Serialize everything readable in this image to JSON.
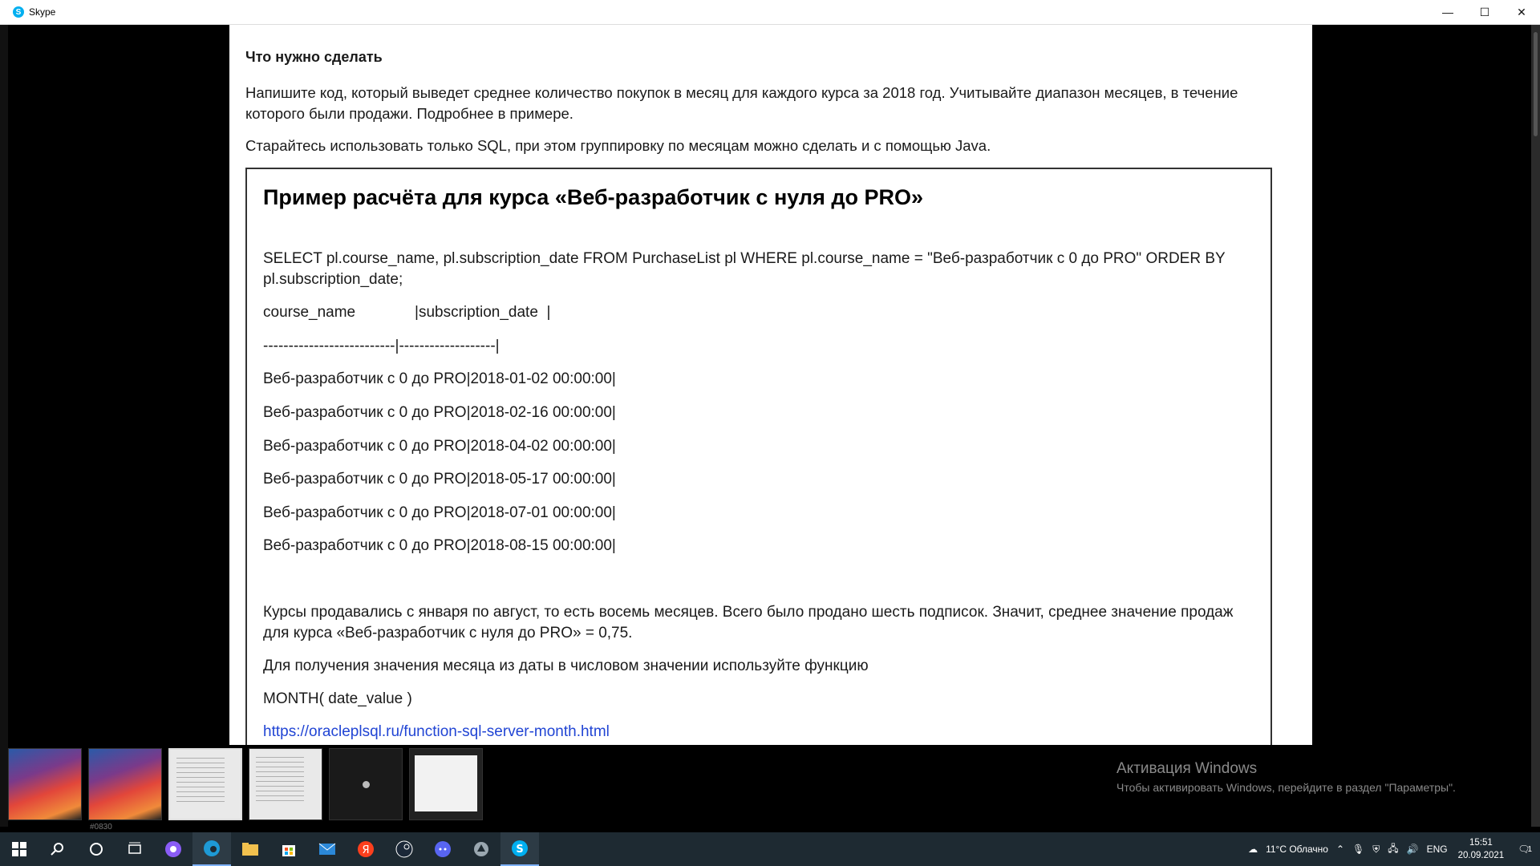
{
  "window": {
    "title": "Skype",
    "app_icon_letter": "S",
    "minimize": "—",
    "maximize": "☐",
    "close": "✕"
  },
  "doc": {
    "section_title": "Что нужно сделать",
    "para1": "Напишите код, который выведет среднее количество покупок в месяц для каждого курса за 2018 год. Учитывайте диапазон месяцев, в течение которого были продажи. Подробнее в примере.",
    "para2": "Старайтесь использовать только SQL, при этом  группировку по месяцам можно сделать и с помощью Java.",
    "example_title": "Пример расчёта для курса «Веб-разработчик с нуля до PRO»",
    "query": "SELECT pl.course_name, pl.subscription_date FROM PurchaseList pl WHERE pl.course_name = \"Веб-разработчик с 0 до PRO\" ORDER BY pl.subscription_date;",
    "header_row": "course_name              |subscription_date  |",
    "separator": "--------------------------|-------------------|",
    "rows": [
      "Веб-разработчик с 0 до PRO|2018-01-02 00:00:00|",
      "Веб-разработчик с 0 до PRO|2018-02-16 00:00:00|",
      "Веб-разработчик с 0 до PRO|2018-04-02 00:00:00|",
      "Веб-разработчик с 0 до PRO|2018-05-17 00:00:00|",
      "Веб-разработчик с 0 до PRO|2018-07-01 00:00:00|",
      "Веб-разработчик с 0 до PRO|2018-08-15 00:00:00|"
    ],
    "conclusion": "Курсы продавались с января по август, то есть восемь месяцев. Всего было продано шесть подписок. Значит, среднее значение продаж для курса «Веб-разработчик с нуля до PRO» = 0,75.",
    "hint": "Для получения значения месяца из даты в числовом значении используйте функцию",
    "function": "MONTH( date_value )",
    "link": "https://oracleplsql.ru/function-sql-server-month.html"
  },
  "activation": {
    "title": "Активация Windows",
    "subtitle": "Чтобы активировать Windows, перейдите в раздел \"Параметры\"."
  },
  "taskbar": {
    "weather": "11°C  Облачно",
    "lang": "ENG",
    "time": "15:51",
    "date": "20.09.2021",
    "notifications": "1",
    "taskbar_fragment": "#0830"
  },
  "colors": {
    "link": "#2145d4",
    "taskbar": "#1e2a32",
    "skype": "#00aff0"
  }
}
